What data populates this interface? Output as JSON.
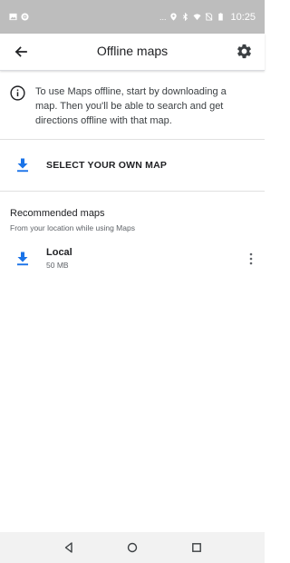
{
  "status_bar": {
    "overflow_dots": "...",
    "time": "10:25",
    "icons": [
      "image-icon",
      "notification-icon",
      "location-icon",
      "bluetooth-icon",
      "wifi-icon",
      "no-sim-icon",
      "battery-icon"
    ]
  },
  "app_bar": {
    "title": "Offline maps",
    "back_icon": "arrow-back-icon",
    "settings_icon": "gear-icon"
  },
  "info": {
    "icon": "info-icon",
    "text": "To use Maps offline, start by downloading a map. Then you'll be able to search and get directions offline with that map."
  },
  "select_own_map": {
    "icon": "download-icon",
    "label": "SELECT YOUR OWN MAP"
  },
  "recommended": {
    "header": "Recommended maps",
    "subtitle": "From your location while using Maps",
    "items": [
      {
        "name": "Local",
        "size": "50 MB",
        "icon": "download-icon",
        "menu_icon": "more-vert-icon"
      }
    ]
  },
  "nav_bar": {
    "icons": [
      "back-triangle-icon",
      "home-circle-icon",
      "recents-square-icon"
    ]
  },
  "colors": {
    "accent": "#1a73e8",
    "status_bar": "#bdbdbd",
    "nav_bar": "#f2f2f2",
    "text_primary": "#202124",
    "text_secondary": "#5f6368"
  }
}
